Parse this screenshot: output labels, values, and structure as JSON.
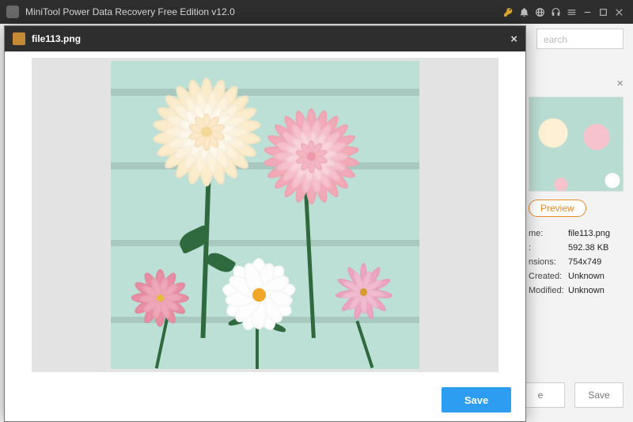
{
  "titlebar": {
    "title": "MiniTool Power Data Recovery Free Edition v12.0"
  },
  "search": {
    "placeholder": "earch"
  },
  "side": {
    "close": "×",
    "preview": "Preview",
    "rows": [
      {
        "k": "me:",
        "v": "file113.png"
      },
      {
        "k": ":",
        "v": "592.38 KB"
      },
      {
        "k": "nsions:",
        "v": "754x749"
      },
      {
        "k": "Created:",
        "v": "Unknown"
      },
      {
        "k": "Modified:",
        "v": "Unknown"
      }
    ]
  },
  "bottom": {
    "btn1": "e",
    "btn2": "Save"
  },
  "modal": {
    "filename": "file113.png",
    "close": "×",
    "save": "Save"
  }
}
